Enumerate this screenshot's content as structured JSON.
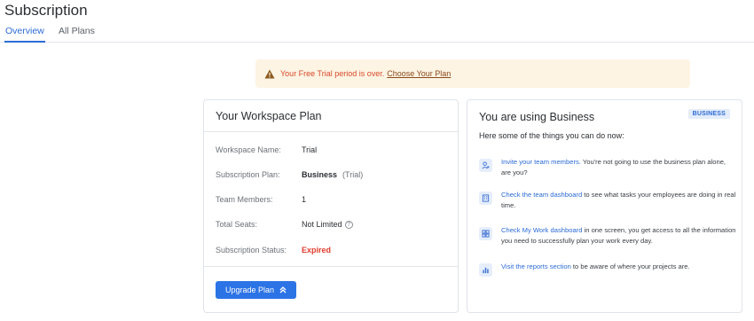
{
  "page": {
    "title": "Subscription"
  },
  "tabs": [
    {
      "label": "Overview",
      "active": true
    },
    {
      "label": "All Plans",
      "active": false
    }
  ],
  "alert": {
    "icon": "warning-icon",
    "message": "Your Free Trial period is over.",
    "cta": "Choose Your Plan"
  },
  "plan": {
    "title": "Your Workspace Plan",
    "rows": [
      {
        "label": "Workspace Name:",
        "value": "Trial"
      },
      {
        "label": "Subscription Plan:",
        "value": "Business",
        "note": "(Trial)"
      },
      {
        "label": "Team Members:",
        "value": "1"
      },
      {
        "label": "Total Seats:",
        "value": "Not Limited",
        "info_icon": "?"
      },
      {
        "label": "Subscription Status:",
        "value": "Expired"
      }
    ],
    "upgrade_label": "Upgrade Plan"
  },
  "business": {
    "title": "You are using Business",
    "badge": "BUSINESS",
    "subtitle": "Here some of the things you can do now:",
    "features": [
      {
        "icon": "invite-user-icon",
        "link": "Invite your team members.",
        "text": " You're not going to use the business plan alone, are you?"
      },
      {
        "icon": "team-dashboard-icon",
        "link": "Check the team dashboard",
        "text": " to see what tasks your employees are doing in real time."
      },
      {
        "icon": "my-work-dashboard-icon",
        "link": "Check My Work dashboard",
        "text": " in one screen, you get access to all the information you need to successfully plan your work every day."
      },
      {
        "icon": "reports-icon",
        "link": "Visit the reports section",
        "text": " to be aware of where your projects are."
      }
    ]
  },
  "colors": {
    "accent": "#2c73e6",
    "alert_bg": "#fdf4e3",
    "alert_text": "#d84a2c",
    "expired": "#e03b2c",
    "badge_bg": "#e4ecfb"
  }
}
